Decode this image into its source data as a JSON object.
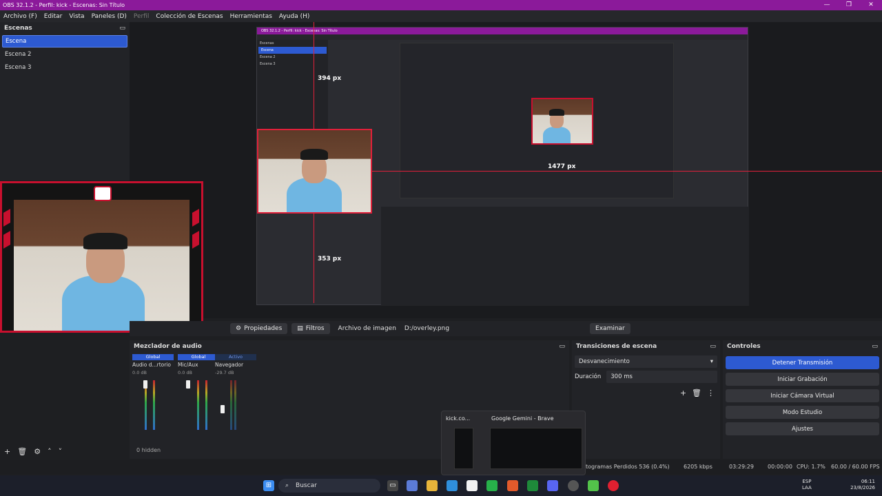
{
  "window": {
    "title": "OBS 32.1.2 - Perfil: kick - Escenas: Sin Título"
  },
  "menu": [
    "Archivo (F)",
    "Editar",
    "Vista",
    "Paneles (D)",
    "Perfil",
    "Colección de Escenas",
    "Herramientas",
    "Ayuda (H)"
  ],
  "scenes": {
    "title": "Escenas",
    "items": [
      "Escena",
      "Escena 2",
      "Escena 3"
    ]
  },
  "preview": {
    "measure_top": "394 px",
    "measure_right": "1477 px",
    "measure_bottom": "353 px",
    "nested_title": "OBS 32.1.2 - Perfil: kick - Escenas: Sin Título"
  },
  "source_toolbar": {
    "properties": "Propiedades",
    "filters": "Filtros",
    "type": "Archivo de imagen",
    "path": "D:/overley.png",
    "browse": "Examinar"
  },
  "mixer": {
    "title": "Mezclador de audio",
    "channels": [
      {
        "group": "Global",
        "name": "Audio d...rtorio",
        "db": "0.0 dB"
      },
      {
        "group": "Global",
        "name": "Mic/Aux",
        "db": "0.0 dB"
      },
      {
        "group": "Activo",
        "name": "Navegador",
        "db": "-29.7 dB"
      }
    ],
    "hidden": "0 hidden"
  },
  "transitions": {
    "title": "Transiciones de escena",
    "selected": "Desvanecimiento",
    "duration_label": "Duración",
    "duration": "300 ms"
  },
  "controls": {
    "title": "Controles",
    "buttons": [
      "Detener Transmisión",
      "Iniciar Grabación",
      "Iniciar Cámara Virtual",
      "Modo Estudio",
      "Ajustes"
    ]
  },
  "status": {
    "dropped": "togramas Perdidos 536 (0.4%)",
    "kbps": "6205 kbps",
    "stream_time": "03:29:29",
    "rec_time": "00:00:00",
    "cpu": "CPU: 1.7%",
    "fps": "60.00 / 60.00 FPS"
  },
  "popup": {
    "app1": "kick.co...",
    "app2": "Google Gemini - Brave"
  },
  "taskbar": {
    "search": "Buscar",
    "lang1": "ESP",
    "lang2": "LAA",
    "time": "06:11",
    "date": "23/8/2026"
  },
  "colors": {
    "accent": "#2d5ad1",
    "title_bar": "#8b1a9a",
    "guide": "#e0203a"
  }
}
